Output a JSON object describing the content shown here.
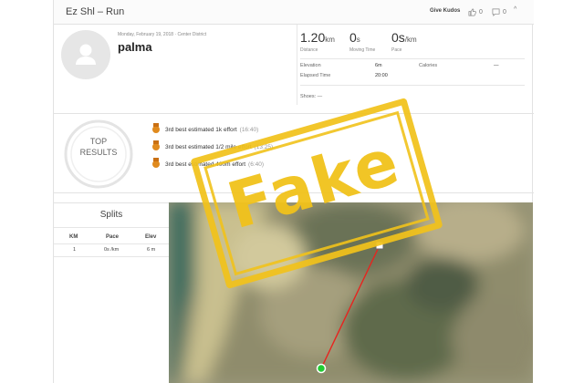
{
  "window": {
    "title": "Ez Shl – Run"
  },
  "header": {
    "give_kudos": "Give Kudos",
    "kudos_count": "0",
    "comments_count": "0",
    "collapse_glyph": "^"
  },
  "athlete": {
    "meta": "Monday, February 19, 2018 · Center District",
    "name": "palma"
  },
  "stats": [
    {
      "value": "1.20",
      "unit": "km",
      "label": "Distance"
    },
    {
      "value": "0",
      "unit": "s",
      "label": "Moving Time"
    },
    {
      "value": "0s",
      "unit": "/km",
      "label": "Pace"
    }
  ],
  "details": {
    "elevation_label": "Elevation",
    "elevation_value": "6m",
    "calories_label": "Calories",
    "calories_value": "—",
    "elapsed_label": "Elapsed Time",
    "elapsed_value": "20:00",
    "shoes": "Shoes: —"
  },
  "top_results": {
    "badge_line1": "TOP",
    "badge_line2": "RESULTS",
    "efforts": [
      {
        "text": "3rd best estimated 1k effort",
        "time": "(16:40)"
      },
      {
        "text": "3rd best estimated 1/2 mile effort",
        "time": "(13:25)"
      },
      {
        "text": "3rd best estimated 400m effort",
        "time": "(6:40)"
      }
    ]
  },
  "splits": {
    "title": "Splits",
    "headers": [
      "KM",
      "Pace",
      "Elev"
    ],
    "rows": [
      [
        "1",
        "0s /km",
        "6 m"
      ]
    ]
  },
  "stamp": {
    "text": "Fake"
  },
  "colors": {
    "stamp": "#f1c21b",
    "medal": "#e08a1e",
    "route": "#e8231e",
    "start_marker": "#22cc33"
  },
  "icons": {
    "thumbs_up": "thumbs-up-icon",
    "comment": "comment-icon",
    "avatar": "user-silhouette-icon",
    "medal": "medal-icon"
  }
}
